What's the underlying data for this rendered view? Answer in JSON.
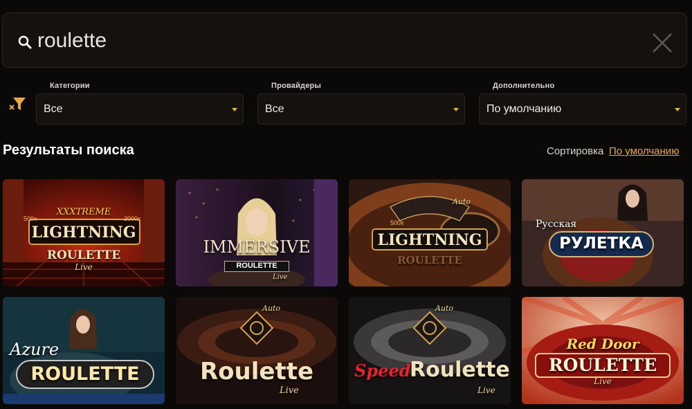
{
  "search": {
    "value": "roulette"
  },
  "filters": [
    {
      "label": "Категории",
      "value": "Все"
    },
    {
      "label": "Провайдеры",
      "value": "Все"
    },
    {
      "label": "Дополнительно",
      "value": "По умолчанию"
    }
  ],
  "results": {
    "title": "Результаты поиска",
    "sort_label": "Сортировка",
    "sort_value": "По умолчанию"
  },
  "games": [
    {
      "title": "LIGHTNING",
      "line1": "XXXTREME",
      "line2": "ROULETTE",
      "line3": "Live",
      "m1": "500x",
      "m2": "2000x"
    },
    {
      "title": "IMMERSIVE",
      "line1": "ROULETTE",
      "line2": "Live"
    },
    {
      "title": "LIGHTNING",
      "line1": "ROULETTE",
      "line2": "Auto",
      "m1": "500x"
    },
    {
      "title": "РУЛЕТКА",
      "line1": "Русская"
    },
    {
      "title": "ROULETTE",
      "line1": "Azure"
    },
    {
      "title": "Roulette",
      "line1": "Live",
      "line2": "Auto"
    },
    {
      "title": "Roulette",
      "line1": "Speed",
      "line2": "Live",
      "line3": "Auto"
    },
    {
      "title": "ROULETTE",
      "line1": "Red Door",
      "line2": "Live"
    }
  ]
}
